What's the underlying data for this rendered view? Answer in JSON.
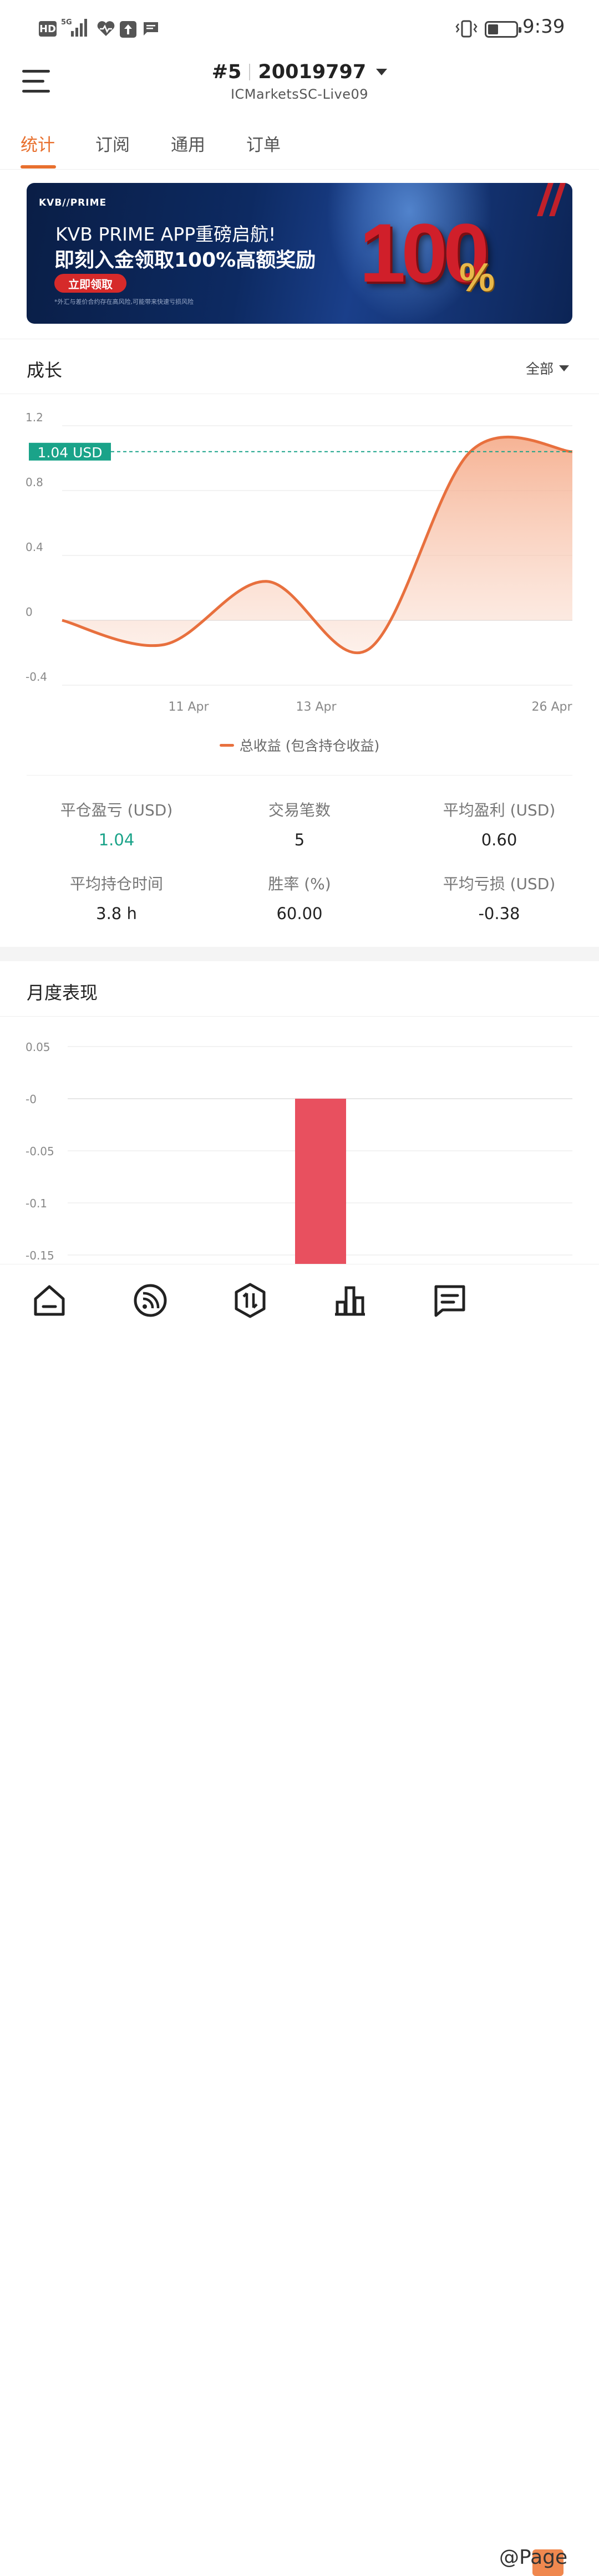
{
  "status_bar": {
    "hd": "HD",
    "network": "5G",
    "time": "9:39"
  },
  "header": {
    "account_number": "#5",
    "account_id": "20019797",
    "server": "ICMarketsSC-Live09"
  },
  "tabs": [
    {
      "label": "统计",
      "active": true
    },
    {
      "label": "订阅",
      "active": false
    },
    {
      "label": "通用",
      "active": false
    },
    {
      "label": "订单",
      "active": false
    }
  ],
  "banner": {
    "logo": "KVB//PRIME",
    "title1": "KVB PRIME APP重磅启航!",
    "title2": "即刻入金领取100%高额奖励",
    "button": "立即领取",
    "note": "*外汇与差价合约存在高风险,可能带来快速亏损风险",
    "big_number": "100",
    "percent": "%"
  },
  "growth": {
    "title": "成长",
    "range": "全部",
    "current_label": "1.04 USD",
    "legend": "总收益 (包含持仓收益)"
  },
  "stats": [
    {
      "label": "平仓盈亏 (USD)",
      "value": "1.04",
      "color": "#1aa389"
    },
    {
      "label": "交易笔数",
      "value": "5"
    },
    {
      "label": "平均盈利 (USD)",
      "value": "0.60"
    },
    {
      "label": "平均持仓时间",
      "value": "3.8 h"
    },
    {
      "label": "胜率 (%)",
      "value": "60.00"
    },
    {
      "label": "平均亏损 (USD)",
      "value": "-0.38"
    }
  ],
  "monthly": {
    "title": "月度表现"
  },
  "nav": [
    "home-icon",
    "feed-icon",
    "trade-icon",
    "chart-icon",
    "message-icon",
    "profile-icon"
  ],
  "watermark": "@Page",
  "chart_data": [
    {
      "type": "area",
      "x_tick_labels": [
        "11 Apr",
        "13 Apr",
        "26 Apr"
      ],
      "y_tick_labels": [
        "1.2",
        "0.8",
        "0.4",
        "0",
        "-0.4"
      ],
      "ylim": [
        -0.4,
        1.2
      ],
      "x_index": [
        0,
        1,
        2,
        3,
        4,
        5
      ],
      "values": [
        0,
        -0.15,
        0.24,
        -0.18,
        1.04,
        1.04
      ],
      "reference_line": 1.04,
      "series": [
        {
          "name": "总收益 (包含持仓收益)",
          "color": "#e8703e"
        }
      ],
      "grid": true,
      "legend": "bottom-center"
    },
    {
      "type": "bar",
      "y_tick_labels": [
        "0.05",
        "-0",
        "-0.05",
        "-0.1",
        "-0.15"
      ],
      "ylim": [
        -0.15,
        0.05
      ],
      "values": [
        -0.16
      ],
      "color": "#e8505f",
      "grid": true
    }
  ]
}
